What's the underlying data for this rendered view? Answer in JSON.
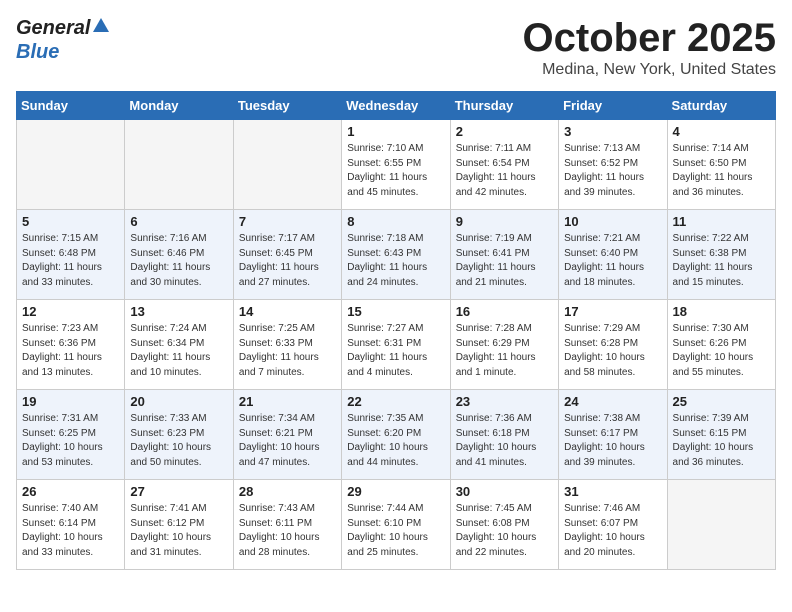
{
  "header": {
    "logo_general": "General",
    "logo_blue": "Blue",
    "month_title": "October 2025",
    "location": "Medina, New York, United States"
  },
  "weekdays": [
    "Sunday",
    "Monday",
    "Tuesday",
    "Wednesday",
    "Thursday",
    "Friday",
    "Saturday"
  ],
  "weeks": [
    [
      {
        "day": "",
        "sunrise": "",
        "sunset": "",
        "daylight": "",
        "empty": true
      },
      {
        "day": "",
        "sunrise": "",
        "sunset": "",
        "daylight": "",
        "empty": true
      },
      {
        "day": "",
        "sunrise": "",
        "sunset": "",
        "daylight": "",
        "empty": true
      },
      {
        "day": "1",
        "sunrise": "Sunrise: 7:10 AM",
        "sunset": "Sunset: 6:55 PM",
        "daylight": "Daylight: 11 hours and 45 minutes.",
        "empty": false
      },
      {
        "day": "2",
        "sunrise": "Sunrise: 7:11 AM",
        "sunset": "Sunset: 6:54 PM",
        "daylight": "Daylight: 11 hours and 42 minutes.",
        "empty": false
      },
      {
        "day": "3",
        "sunrise": "Sunrise: 7:13 AM",
        "sunset": "Sunset: 6:52 PM",
        "daylight": "Daylight: 11 hours and 39 minutes.",
        "empty": false
      },
      {
        "day": "4",
        "sunrise": "Sunrise: 7:14 AM",
        "sunset": "Sunset: 6:50 PM",
        "daylight": "Daylight: 11 hours and 36 minutes.",
        "empty": false
      }
    ],
    [
      {
        "day": "5",
        "sunrise": "Sunrise: 7:15 AM",
        "sunset": "Sunset: 6:48 PM",
        "daylight": "Daylight: 11 hours and 33 minutes.",
        "empty": false
      },
      {
        "day": "6",
        "sunrise": "Sunrise: 7:16 AM",
        "sunset": "Sunset: 6:46 PM",
        "daylight": "Daylight: 11 hours and 30 minutes.",
        "empty": false
      },
      {
        "day": "7",
        "sunrise": "Sunrise: 7:17 AM",
        "sunset": "Sunset: 6:45 PM",
        "daylight": "Daylight: 11 hours and 27 minutes.",
        "empty": false
      },
      {
        "day": "8",
        "sunrise": "Sunrise: 7:18 AM",
        "sunset": "Sunset: 6:43 PM",
        "daylight": "Daylight: 11 hours and 24 minutes.",
        "empty": false
      },
      {
        "day": "9",
        "sunrise": "Sunrise: 7:19 AM",
        "sunset": "Sunset: 6:41 PM",
        "daylight": "Daylight: 11 hours and 21 minutes.",
        "empty": false
      },
      {
        "day": "10",
        "sunrise": "Sunrise: 7:21 AM",
        "sunset": "Sunset: 6:40 PM",
        "daylight": "Daylight: 11 hours and 18 minutes.",
        "empty": false
      },
      {
        "day": "11",
        "sunrise": "Sunrise: 7:22 AM",
        "sunset": "Sunset: 6:38 PM",
        "daylight": "Daylight: 11 hours and 15 minutes.",
        "empty": false
      }
    ],
    [
      {
        "day": "12",
        "sunrise": "Sunrise: 7:23 AM",
        "sunset": "Sunset: 6:36 PM",
        "daylight": "Daylight: 11 hours and 13 minutes.",
        "empty": false
      },
      {
        "day": "13",
        "sunrise": "Sunrise: 7:24 AM",
        "sunset": "Sunset: 6:34 PM",
        "daylight": "Daylight: 11 hours and 10 minutes.",
        "empty": false
      },
      {
        "day": "14",
        "sunrise": "Sunrise: 7:25 AM",
        "sunset": "Sunset: 6:33 PM",
        "daylight": "Daylight: 11 hours and 7 minutes.",
        "empty": false
      },
      {
        "day": "15",
        "sunrise": "Sunrise: 7:27 AM",
        "sunset": "Sunset: 6:31 PM",
        "daylight": "Daylight: 11 hours and 4 minutes.",
        "empty": false
      },
      {
        "day": "16",
        "sunrise": "Sunrise: 7:28 AM",
        "sunset": "Sunset: 6:29 PM",
        "daylight": "Daylight: 11 hours and 1 minute.",
        "empty": false
      },
      {
        "day": "17",
        "sunrise": "Sunrise: 7:29 AM",
        "sunset": "Sunset: 6:28 PM",
        "daylight": "Daylight: 10 hours and 58 minutes.",
        "empty": false
      },
      {
        "day": "18",
        "sunrise": "Sunrise: 7:30 AM",
        "sunset": "Sunset: 6:26 PM",
        "daylight": "Daylight: 10 hours and 55 minutes.",
        "empty": false
      }
    ],
    [
      {
        "day": "19",
        "sunrise": "Sunrise: 7:31 AM",
        "sunset": "Sunset: 6:25 PM",
        "daylight": "Daylight: 10 hours and 53 minutes.",
        "empty": false
      },
      {
        "day": "20",
        "sunrise": "Sunrise: 7:33 AM",
        "sunset": "Sunset: 6:23 PM",
        "daylight": "Daylight: 10 hours and 50 minutes.",
        "empty": false
      },
      {
        "day": "21",
        "sunrise": "Sunrise: 7:34 AM",
        "sunset": "Sunset: 6:21 PM",
        "daylight": "Daylight: 10 hours and 47 minutes.",
        "empty": false
      },
      {
        "day": "22",
        "sunrise": "Sunrise: 7:35 AM",
        "sunset": "Sunset: 6:20 PM",
        "daylight": "Daylight: 10 hours and 44 minutes.",
        "empty": false
      },
      {
        "day": "23",
        "sunrise": "Sunrise: 7:36 AM",
        "sunset": "Sunset: 6:18 PM",
        "daylight": "Daylight: 10 hours and 41 minutes.",
        "empty": false
      },
      {
        "day": "24",
        "sunrise": "Sunrise: 7:38 AM",
        "sunset": "Sunset: 6:17 PM",
        "daylight": "Daylight: 10 hours and 39 minutes.",
        "empty": false
      },
      {
        "day": "25",
        "sunrise": "Sunrise: 7:39 AM",
        "sunset": "Sunset: 6:15 PM",
        "daylight": "Daylight: 10 hours and 36 minutes.",
        "empty": false
      }
    ],
    [
      {
        "day": "26",
        "sunrise": "Sunrise: 7:40 AM",
        "sunset": "Sunset: 6:14 PM",
        "daylight": "Daylight: 10 hours and 33 minutes.",
        "empty": false
      },
      {
        "day": "27",
        "sunrise": "Sunrise: 7:41 AM",
        "sunset": "Sunset: 6:12 PM",
        "daylight": "Daylight: 10 hours and 31 minutes.",
        "empty": false
      },
      {
        "day": "28",
        "sunrise": "Sunrise: 7:43 AM",
        "sunset": "Sunset: 6:11 PM",
        "daylight": "Daylight: 10 hours and 28 minutes.",
        "empty": false
      },
      {
        "day": "29",
        "sunrise": "Sunrise: 7:44 AM",
        "sunset": "Sunset: 6:10 PM",
        "daylight": "Daylight: 10 hours and 25 minutes.",
        "empty": false
      },
      {
        "day": "30",
        "sunrise": "Sunrise: 7:45 AM",
        "sunset": "Sunset: 6:08 PM",
        "daylight": "Daylight: 10 hours and 22 minutes.",
        "empty": false
      },
      {
        "day": "31",
        "sunrise": "Sunrise: 7:46 AM",
        "sunset": "Sunset: 6:07 PM",
        "daylight": "Daylight: 10 hours and 20 minutes.",
        "empty": false
      },
      {
        "day": "",
        "sunrise": "",
        "sunset": "",
        "daylight": "",
        "empty": true
      }
    ]
  ]
}
